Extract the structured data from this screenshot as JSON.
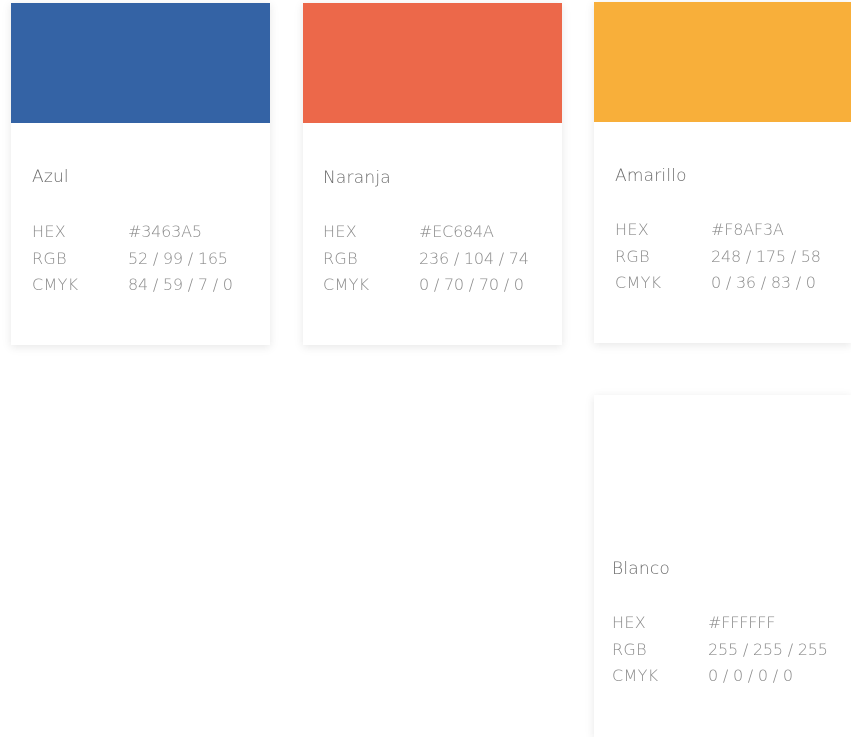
{
  "colors": [
    {
      "name": "Azul",
      "swatch": "#3463A5",
      "specs": [
        {
          "label": "HEX",
          "value": "#3463A5"
        },
        {
          "label": "RGB",
          "value": "52 / 99 / 165"
        },
        {
          "label": "CMYK",
          "value": "84 / 59 / 7 / 0"
        }
      ]
    },
    {
      "name": "Naranja",
      "swatch": "#EC684A",
      "specs": [
        {
          "label": "HEX",
          "value": "#EC684A"
        },
        {
          "label": "RGB",
          "value": "236 / 104 / 74"
        },
        {
          "label": "CMYK",
          "value": "0 / 70 / 70 / 0"
        }
      ]
    },
    {
      "name": "Amarillo",
      "swatch": "#F8AF3A",
      "specs": [
        {
          "label": "HEX",
          "value": "#F8AF3A"
        },
        {
          "label": "RGB",
          "value": "248 / 175 / 58"
        },
        {
          "label": "CMYK",
          "value": "0 / 36 / 83 / 0"
        }
      ]
    },
    {
      "name": "Blanco",
      "swatch": "#FFFFFF",
      "specs": [
        {
          "label": "HEX",
          "value": "#FFFFFF"
        },
        {
          "label": "RGB",
          "value": "255 / 255 / 255"
        },
        {
          "label": "CMYK",
          "value": "0 / 0 / 0 / 0"
        }
      ]
    }
  ]
}
